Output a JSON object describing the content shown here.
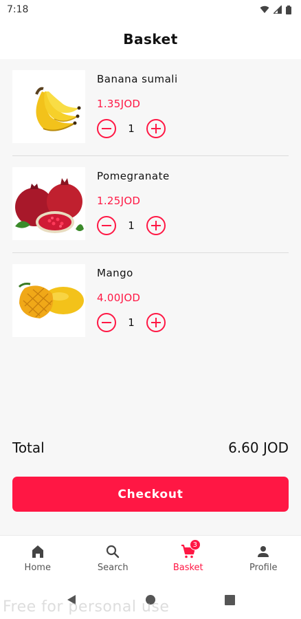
{
  "status_bar": {
    "time": "7:18"
  },
  "header": {
    "title": "Basket"
  },
  "items": [
    {
      "name": "Banana sumali",
      "price": "1.35JOD",
      "quantity": "1",
      "image": "banana-image"
    },
    {
      "name": "Pomegranate",
      "price": "1.25JOD",
      "quantity": "1",
      "image": "pomegranate-image"
    },
    {
      "name": "Mango",
      "price": "4.00JOD",
      "quantity": "1",
      "image": "mango-image"
    }
  ],
  "summary": {
    "total_label": "Total",
    "total_value": "6.60 JOD"
  },
  "checkout_label": "Checkout",
  "bottom_nav": [
    {
      "label": "Home",
      "icon": "home-icon"
    },
    {
      "label": "Search",
      "icon": "search-icon"
    },
    {
      "label": "Basket",
      "icon": "cart-icon",
      "badge": "3",
      "active": true
    },
    {
      "label": "Profile",
      "icon": "person-icon"
    }
  ],
  "watermark": "Free for personal use",
  "colors": {
    "accent": "#ff1744",
    "background": "#f7f7f7",
    "surface": "#ffffff"
  }
}
